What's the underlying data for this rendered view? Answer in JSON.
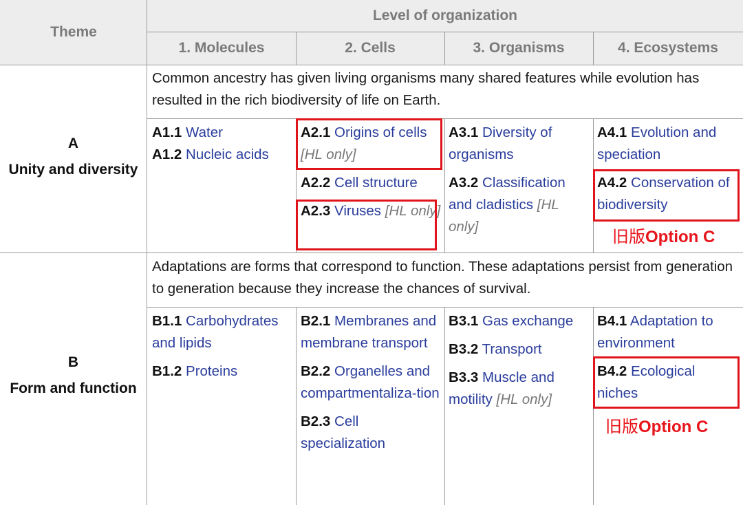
{
  "header": {
    "theme": "Theme",
    "level": "Level of organization",
    "columns": [
      "1. Molecules",
      "2. Cells",
      "3. Organisms",
      "4. Ecosystems"
    ]
  },
  "rows": [
    {
      "letter": "A",
      "name": "Unity and diversity",
      "intro": "Common ancestry has given living organisms many shared features while evolution has resulted in the rich biodiversity of life on Earth.",
      "cols": [
        [
          {
            "code": "A1.1",
            "label": "Water",
            "hl": ""
          },
          {
            "code": "A1.2",
            "label": "Nucleic acids",
            "hl": ""
          }
        ],
        [
          {
            "code": "A2.1",
            "label": "Origins of cells",
            "hl": "[HL only]"
          },
          {
            "code": "A2.2",
            "label": "Cell structure",
            "hl": ""
          },
          {
            "code": "A2.3",
            "label": "Viruses",
            "hl": "[HL only]"
          }
        ],
        [
          {
            "code": "A3.1",
            "label": "Diversity of organisms",
            "hl": ""
          },
          {
            "code": "A3.2",
            "label": "Classification and cladistics",
            "hl": "[HL only]"
          }
        ],
        [
          {
            "code": "A4.1",
            "label": "Evolution and speciation",
            "hl": ""
          },
          {
            "code": "A4.2",
            "label": "Conservation of biodiversity",
            "hl": ""
          }
        ]
      ]
    },
    {
      "letter": "B",
      "name": "Form and function",
      "intro": "Adaptations are forms that correspond to function. These adaptations persist from generation to generation because they increase the chances of survival.",
      "cols": [
        [
          {
            "code": "B1.1",
            "label": "Carbohydrates and lipids",
            "hl": ""
          },
          {
            "code": "B1.2",
            "label": "Proteins",
            "hl": ""
          }
        ],
        [
          {
            "code": "B2.1",
            "label": "Membranes and membrane transport",
            "hl": ""
          },
          {
            "code": "B2.2",
            "label": "Organelles and compartmentaliza-tion",
            "hl": ""
          },
          {
            "code": "B2.3",
            "label": "Cell specialization",
            "hl": ""
          }
        ],
        [
          {
            "code": "B3.1",
            "label": "Gas exchange",
            "hl": ""
          },
          {
            "code": "B3.2",
            "label": "Transport",
            "hl": ""
          },
          {
            "code": "B3.3",
            "label": "Muscle and motility",
            "hl": "[HL only]"
          }
        ],
        [
          {
            "code": "B4.1",
            "label": "Adaptation to environment",
            "hl": ""
          },
          {
            "code": "B4.2",
            "label": "Ecological niches",
            "hl": ""
          }
        ]
      ]
    }
  ],
  "annotations": {
    "note_prefix": "旧版",
    "note_suffix": "Option C",
    "color": "#e0141b"
  }
}
